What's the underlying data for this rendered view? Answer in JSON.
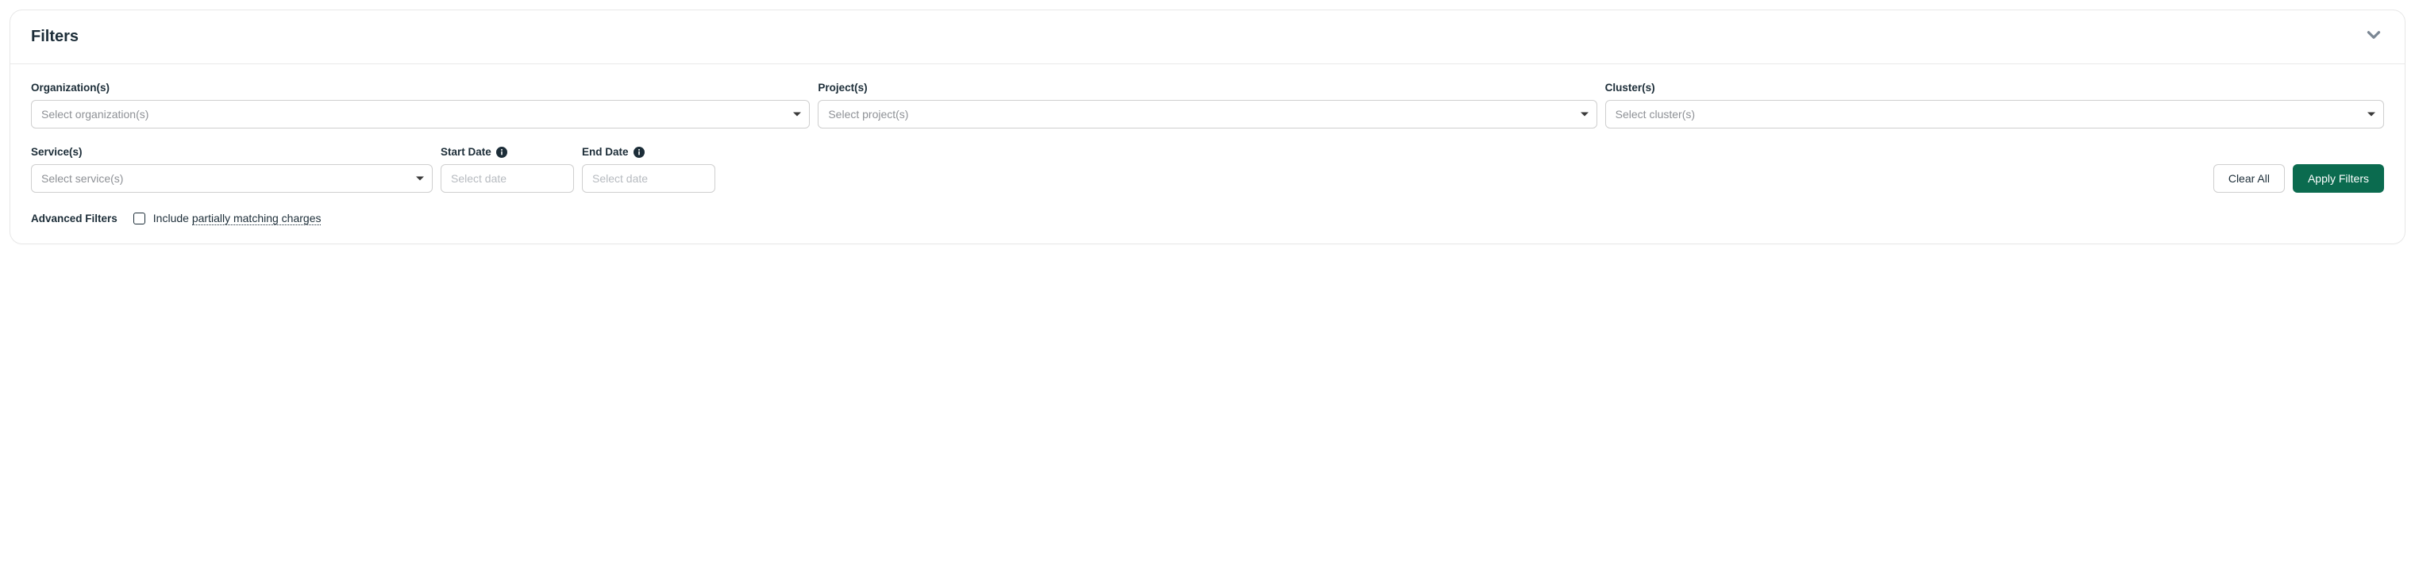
{
  "panel": {
    "title": "Filters"
  },
  "fields": {
    "org": {
      "label": "Organization(s)",
      "placeholder": "Select organization(s)"
    },
    "project": {
      "label": "Project(s)",
      "placeholder": "Select project(s)"
    },
    "cluster": {
      "label": "Cluster(s)",
      "placeholder": "Select cluster(s)"
    },
    "service": {
      "label": "Service(s)",
      "placeholder": "Select service(s)"
    },
    "start_date": {
      "label": "Start Date",
      "placeholder": "Select date"
    },
    "end_date": {
      "label": "End Date",
      "placeholder": "Select date"
    }
  },
  "actions": {
    "clear": "Clear All",
    "apply": "Apply Filters"
  },
  "advanced": {
    "title": "Advanced Filters",
    "include_prefix": "Include ",
    "include_dotted": "partially matching charges"
  }
}
